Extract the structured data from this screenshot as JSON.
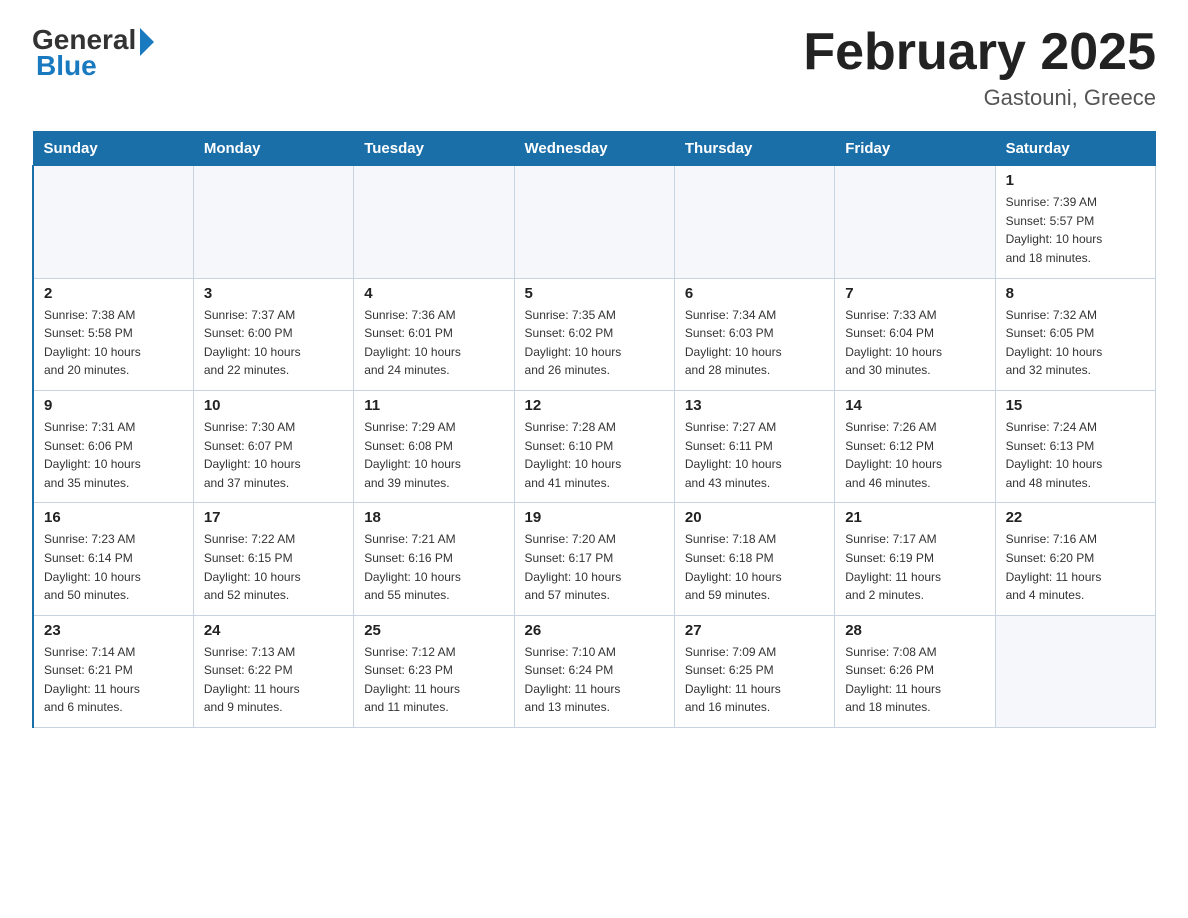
{
  "header": {
    "logo_general": "General",
    "logo_blue": "Blue",
    "title": "February 2025",
    "subtitle": "Gastouni, Greece"
  },
  "days_of_week": [
    "Sunday",
    "Monday",
    "Tuesday",
    "Wednesday",
    "Thursday",
    "Friday",
    "Saturday"
  ],
  "weeks": [
    [
      {
        "day": "",
        "info": "",
        "empty": true
      },
      {
        "day": "",
        "info": "",
        "empty": true
      },
      {
        "day": "",
        "info": "",
        "empty": true
      },
      {
        "day": "",
        "info": "",
        "empty": true
      },
      {
        "day": "",
        "info": "",
        "empty": true
      },
      {
        "day": "",
        "info": "",
        "empty": true
      },
      {
        "day": "1",
        "info": "Sunrise: 7:39 AM\nSunset: 5:57 PM\nDaylight: 10 hours\nand 18 minutes."
      }
    ],
    [
      {
        "day": "2",
        "info": "Sunrise: 7:38 AM\nSunset: 5:58 PM\nDaylight: 10 hours\nand 20 minutes."
      },
      {
        "day": "3",
        "info": "Sunrise: 7:37 AM\nSunset: 6:00 PM\nDaylight: 10 hours\nand 22 minutes."
      },
      {
        "day": "4",
        "info": "Sunrise: 7:36 AM\nSunset: 6:01 PM\nDaylight: 10 hours\nand 24 minutes."
      },
      {
        "day": "5",
        "info": "Sunrise: 7:35 AM\nSunset: 6:02 PM\nDaylight: 10 hours\nand 26 minutes."
      },
      {
        "day": "6",
        "info": "Sunrise: 7:34 AM\nSunset: 6:03 PM\nDaylight: 10 hours\nand 28 minutes."
      },
      {
        "day": "7",
        "info": "Sunrise: 7:33 AM\nSunset: 6:04 PM\nDaylight: 10 hours\nand 30 minutes."
      },
      {
        "day": "8",
        "info": "Sunrise: 7:32 AM\nSunset: 6:05 PM\nDaylight: 10 hours\nand 32 minutes."
      }
    ],
    [
      {
        "day": "9",
        "info": "Sunrise: 7:31 AM\nSunset: 6:06 PM\nDaylight: 10 hours\nand 35 minutes."
      },
      {
        "day": "10",
        "info": "Sunrise: 7:30 AM\nSunset: 6:07 PM\nDaylight: 10 hours\nand 37 minutes."
      },
      {
        "day": "11",
        "info": "Sunrise: 7:29 AM\nSunset: 6:08 PM\nDaylight: 10 hours\nand 39 minutes."
      },
      {
        "day": "12",
        "info": "Sunrise: 7:28 AM\nSunset: 6:10 PM\nDaylight: 10 hours\nand 41 minutes."
      },
      {
        "day": "13",
        "info": "Sunrise: 7:27 AM\nSunset: 6:11 PM\nDaylight: 10 hours\nand 43 minutes."
      },
      {
        "day": "14",
        "info": "Sunrise: 7:26 AM\nSunset: 6:12 PM\nDaylight: 10 hours\nand 46 minutes."
      },
      {
        "day": "15",
        "info": "Sunrise: 7:24 AM\nSunset: 6:13 PM\nDaylight: 10 hours\nand 48 minutes."
      }
    ],
    [
      {
        "day": "16",
        "info": "Sunrise: 7:23 AM\nSunset: 6:14 PM\nDaylight: 10 hours\nand 50 minutes."
      },
      {
        "day": "17",
        "info": "Sunrise: 7:22 AM\nSunset: 6:15 PM\nDaylight: 10 hours\nand 52 minutes."
      },
      {
        "day": "18",
        "info": "Sunrise: 7:21 AM\nSunset: 6:16 PM\nDaylight: 10 hours\nand 55 minutes."
      },
      {
        "day": "19",
        "info": "Sunrise: 7:20 AM\nSunset: 6:17 PM\nDaylight: 10 hours\nand 57 minutes."
      },
      {
        "day": "20",
        "info": "Sunrise: 7:18 AM\nSunset: 6:18 PM\nDaylight: 10 hours\nand 59 minutes."
      },
      {
        "day": "21",
        "info": "Sunrise: 7:17 AM\nSunset: 6:19 PM\nDaylight: 11 hours\nand 2 minutes."
      },
      {
        "day": "22",
        "info": "Sunrise: 7:16 AM\nSunset: 6:20 PM\nDaylight: 11 hours\nand 4 minutes."
      }
    ],
    [
      {
        "day": "23",
        "info": "Sunrise: 7:14 AM\nSunset: 6:21 PM\nDaylight: 11 hours\nand 6 minutes."
      },
      {
        "day": "24",
        "info": "Sunrise: 7:13 AM\nSunset: 6:22 PM\nDaylight: 11 hours\nand 9 minutes."
      },
      {
        "day": "25",
        "info": "Sunrise: 7:12 AM\nSunset: 6:23 PM\nDaylight: 11 hours\nand 11 minutes."
      },
      {
        "day": "26",
        "info": "Sunrise: 7:10 AM\nSunset: 6:24 PM\nDaylight: 11 hours\nand 13 minutes."
      },
      {
        "day": "27",
        "info": "Sunrise: 7:09 AM\nSunset: 6:25 PM\nDaylight: 11 hours\nand 16 minutes."
      },
      {
        "day": "28",
        "info": "Sunrise: 7:08 AM\nSunset: 6:26 PM\nDaylight: 11 hours\nand 18 minutes."
      },
      {
        "day": "",
        "info": "",
        "empty": true
      }
    ]
  ]
}
